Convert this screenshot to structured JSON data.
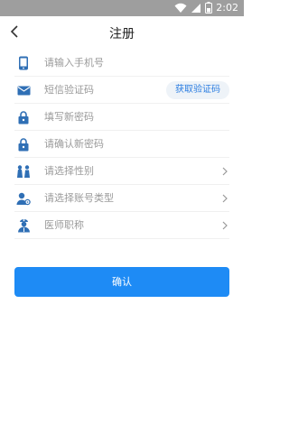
{
  "status_bar": {
    "time": "2:02",
    "icons": [
      "wifi-icon",
      "signal-icon",
      "battery-icon"
    ],
    "background": "#9e9e9e"
  },
  "header": {
    "title": "注册",
    "back_icon": "chevron-left-icon"
  },
  "form": {
    "phone": {
      "placeholder": "请输入手机号",
      "icon": "phone-icon"
    },
    "sms_code": {
      "placeholder": "短信验证码",
      "icon": "envelope-icon",
      "button_label": "获取验证码"
    },
    "new_password": {
      "placeholder": "填写新密码",
      "icon": "lock-icon"
    },
    "confirm_password": {
      "placeholder": "请确认新密码",
      "icon": "lock-icon"
    },
    "gender": {
      "label": "请选择性别",
      "icon": "gender-icon"
    },
    "account_type": {
      "label": "请选择账号类型",
      "icon": "user-settings-icon"
    },
    "doctor_title": {
      "label": "医师职称",
      "icon": "doctor-icon"
    }
  },
  "actions": {
    "confirm_label": "确认"
  },
  "colors": {
    "accent": "#1e8bf5",
    "icon": "#2f6fb5",
    "placeholder": "#9a9a9a"
  }
}
